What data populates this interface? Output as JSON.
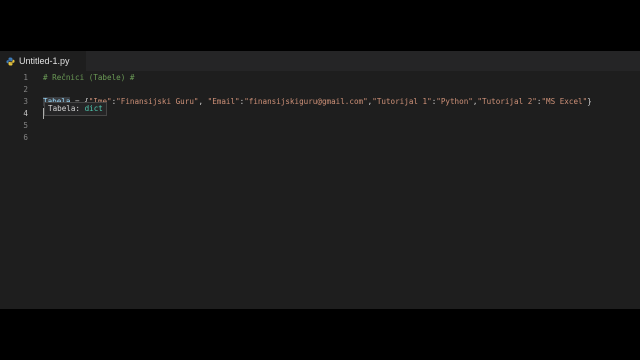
{
  "tab": {
    "label": "Untitled-1.py",
    "icon": "python-icon"
  },
  "editor": {
    "line_numbers": [
      "1",
      "2",
      "3",
      "4",
      "5",
      "6"
    ],
    "line1": {
      "comment": "# Rečnici (Tabele) #"
    },
    "line3": {
      "var": "Tabela",
      "assign": " = {",
      "k1": "\"Ime\"",
      "c1": ":",
      "v1": "\"Finansijski Guru\"",
      "s1": ", ",
      "k2": "\"Email\"",
      "c2": ":",
      "v2": "\"finansijskiguru@gmail.com\"",
      "s2": ",",
      "k3": "\"Tutorijal 1\"",
      "c3": ":",
      "v3": "\"Python\"",
      "s3": ",",
      "k4": "\"Tutorijal 2\"",
      "c4": ":",
      "v4": "\"MS Excel\"",
      "close": "}"
    },
    "hover": {
      "name": "Tabela: ",
      "type": "dict"
    }
  },
  "colors": {
    "background": "#1e1e1e",
    "comment": "#6a9955",
    "variable": "#9cdcfe",
    "string": "#ce9178",
    "type": "#4ec9b0"
  }
}
